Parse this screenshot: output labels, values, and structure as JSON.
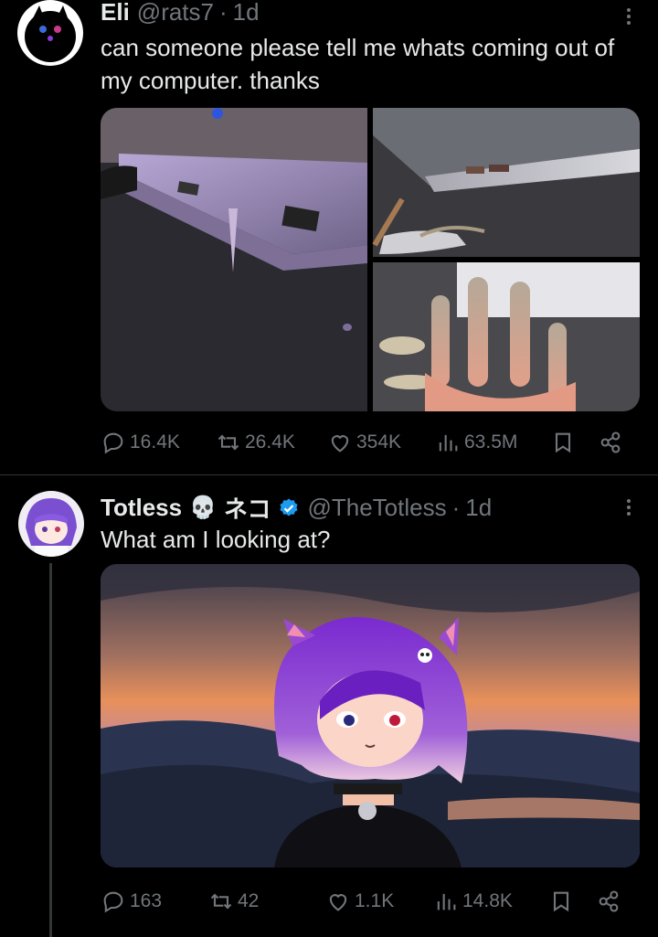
{
  "tweets": [
    {
      "name": "Eli",
      "handle": "@rats7",
      "separator": "·",
      "time": "1d",
      "text": "can someone please tell me whats coming out of my computer. thanks",
      "stats": {
        "replies": "16.4K",
        "retweets": "26.4K",
        "likes": "354K",
        "views": "63.5M"
      }
    },
    {
      "name": "Totless",
      "emoji": "💀",
      "neko": "ネコ",
      "handle": "@TheTotless",
      "separator": "·",
      "time": "1d",
      "text": "What am I looking at?",
      "stats": {
        "replies": "163",
        "retweets": "42",
        "likes": "1.1K",
        "views": "14.8K"
      }
    }
  ],
  "colors": {
    "background": "#000000",
    "text": "#e7e9ea",
    "muted": "#71767b",
    "verified": "#1d9bf0"
  }
}
